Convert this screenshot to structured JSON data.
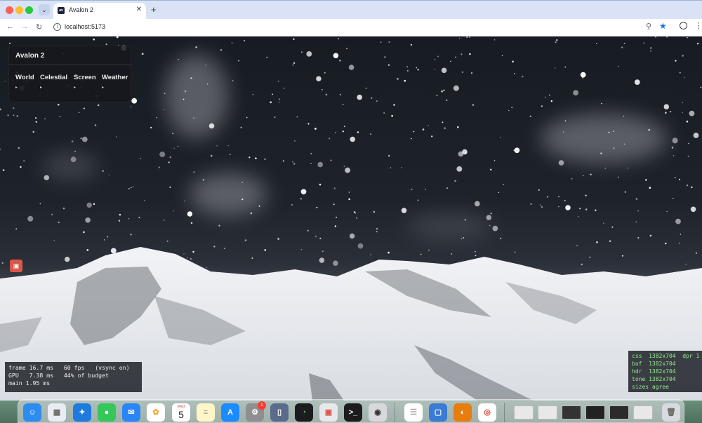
{
  "browser": {
    "tab_title": "Avalon 2",
    "favicon_text": "av",
    "url": "localhost:5173"
  },
  "panel": {
    "title": "Avalon 2",
    "tabs": [
      "World",
      "Celestial",
      "Screen",
      "Weather"
    ],
    "caret": "▸"
  },
  "stats": {
    "line1": "frame 16.7 ms   60 fps   (vsync on)",
    "line2": "GPU   7.38 ms   44% of budget",
    "line3": "main 1.95 ms"
  },
  "sizes": {
    "line1": "css  1382x704  dpr 1",
    "line2": "buf  1382x704",
    "line3": "hdr  1382x704",
    "line4": "tone 1382x704",
    "line5": "sizes agree"
  },
  "dock": {
    "calendar_month": "Wed",
    "calendar_day": "5",
    "settings_badge": "1",
    "apps": [
      "finder-icon",
      "launchpad-icon",
      "safari-icon",
      "messages-icon",
      "mail-icon",
      "photos-icon",
      "calendar-icon",
      "notes-icon",
      "app-store-icon",
      "system-settings-icon",
      "preview-icon",
      "activity-monitor-icon",
      "reminders-app-icon",
      "terminal-icon",
      "camera-icon",
      "textedit-icon",
      "simulator-icon",
      "blender-icon",
      "chrome-icon"
    ]
  },
  "colors": {
    "accent": "#1a73e8",
    "stats_text": "#f0f0f0",
    "sizes_text": "#8ef08e"
  }
}
